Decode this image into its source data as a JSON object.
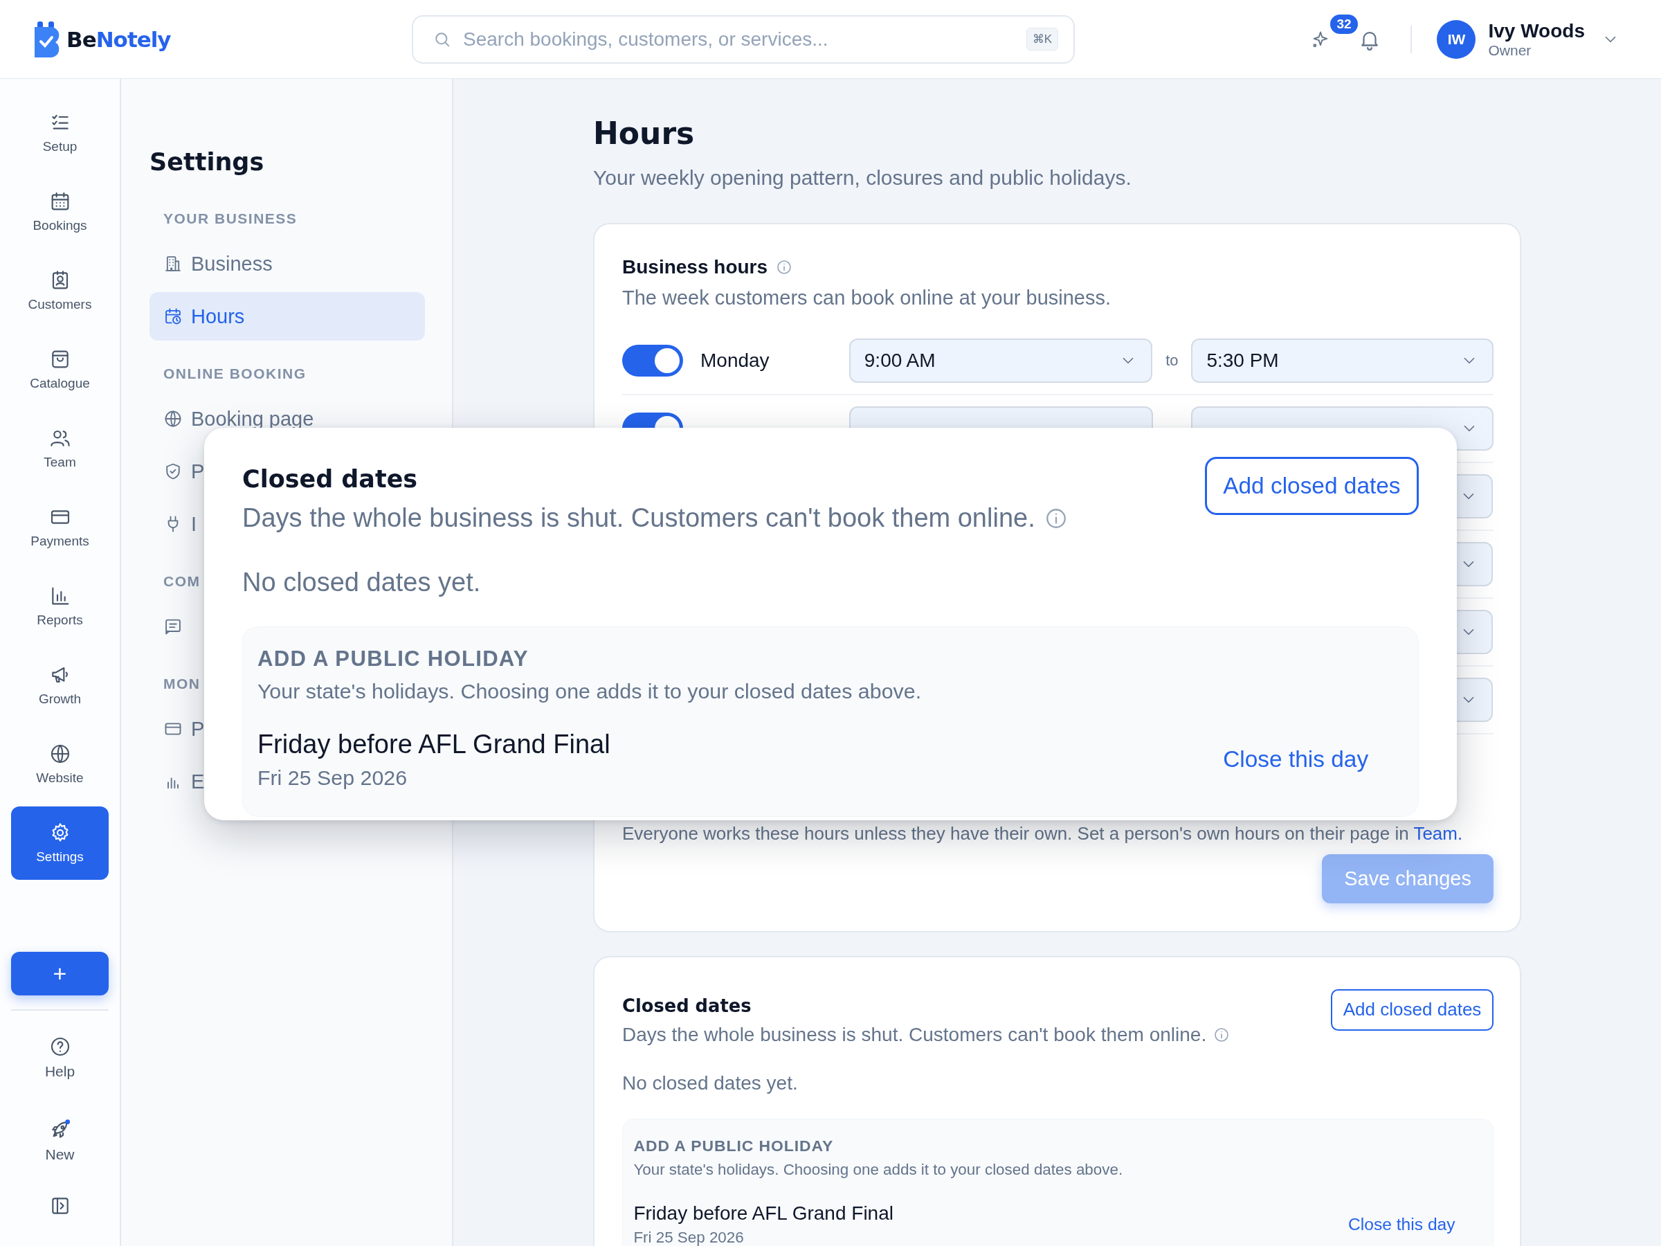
{
  "brand": {
    "parts": [
      "Be",
      "Notely"
    ]
  },
  "search": {
    "placeholder": "Search bookings, customers, or services...",
    "shortcut": "⌘K"
  },
  "header": {
    "notification_count": "32",
    "user": {
      "initials": "IW",
      "name": "Ivy Woods",
      "role": "Owner"
    }
  },
  "rail": {
    "items": [
      {
        "label": "Setup",
        "selected": false
      },
      {
        "label": "Bookings",
        "selected": false
      },
      {
        "label": "Customers",
        "selected": false
      },
      {
        "label": "Catalogue",
        "selected": false
      },
      {
        "label": "Team",
        "selected": false
      },
      {
        "label": "Payments",
        "selected": false
      },
      {
        "label": "Reports",
        "selected": false
      },
      {
        "label": "Growth",
        "selected": false
      },
      {
        "label": "Website",
        "selected": false
      },
      {
        "label": "Settings",
        "selected": true
      }
    ],
    "add_button": "+",
    "bottom_items": [
      {
        "label": "Help"
      },
      {
        "label": "New"
      }
    ]
  },
  "settings_nav": {
    "title": "Settings",
    "sections": [
      {
        "heading": "YOUR BUSINESS",
        "items": [
          {
            "label": "Business",
            "selected": false
          },
          {
            "label": "Hours",
            "selected": true
          }
        ]
      },
      {
        "heading": "ONLINE BOOKING",
        "items": [
          {
            "label": "Booking page",
            "selected": false
          },
          {
            "label": "P",
            "selected": false
          },
          {
            "label": "I",
            "selected": false
          }
        ]
      },
      {
        "heading": "COM",
        "items": [
          {
            "selected": false
          }
        ]
      },
      {
        "heading": "MON",
        "items": [
          {
            "label": "P",
            "selected": false
          },
          {
            "label": "E",
            "selected": false
          }
        ]
      }
    ]
  },
  "page": {
    "title": "Hours",
    "subtitle": "Your weekly opening pattern, closures and public holidays."
  },
  "business_hours": {
    "title": "Business hours",
    "subtitle": "The week customers can book online at your business.",
    "days": [
      {
        "kind": "day",
        "day": "Monday",
        "on": true,
        "from": "9:00 AM",
        "to_label": "to",
        "to": "5:30 PM"
      },
      {
        "kind": "covered",
        "on": true
      },
      {
        "kind": "covered"
      },
      {
        "kind": "covered"
      },
      {
        "kind": "covered"
      },
      {
        "kind": "covered"
      }
    ],
    "note": "Everyone works these hours unless they have their own. Set a person's own hours on their page in",
    "note_link": "Team.",
    "save_button": "Save changes",
    "save_disabled": true
  },
  "closed_dates": {
    "title": "Closed dates",
    "subtitle": "Days the whole business is shut. Customers can't book them online.",
    "button": "Add closed dates",
    "empty": "No closed dates yet.",
    "holidays": {
      "heading": "ADD A PUBLIC HOLIDAY",
      "description": "Your state's holidays. Choosing one adds it to your closed dates above.",
      "items": [
        {
          "name": "Friday before AFL Grand Final",
          "date": "Fri 25 Sep 2026",
          "action": "Close this day"
        }
      ]
    }
  },
  "zoom_overlay": {
    "title": "Closed dates",
    "subtitle": "Days the whole business is shut. Customers can't book them online.",
    "button": "Add closed dates",
    "empty": "No closed dates yet.",
    "holidays": {
      "heading": "ADD A PUBLIC HOLIDAY",
      "description": "Your state's holidays. Choosing one adds it to your closed dates above.",
      "items": [
        {
          "name": "Friday before AFL Grand Final",
          "date": "Fri 25 Sep 2026",
          "action": "Close this day"
        }
      ]
    }
  }
}
